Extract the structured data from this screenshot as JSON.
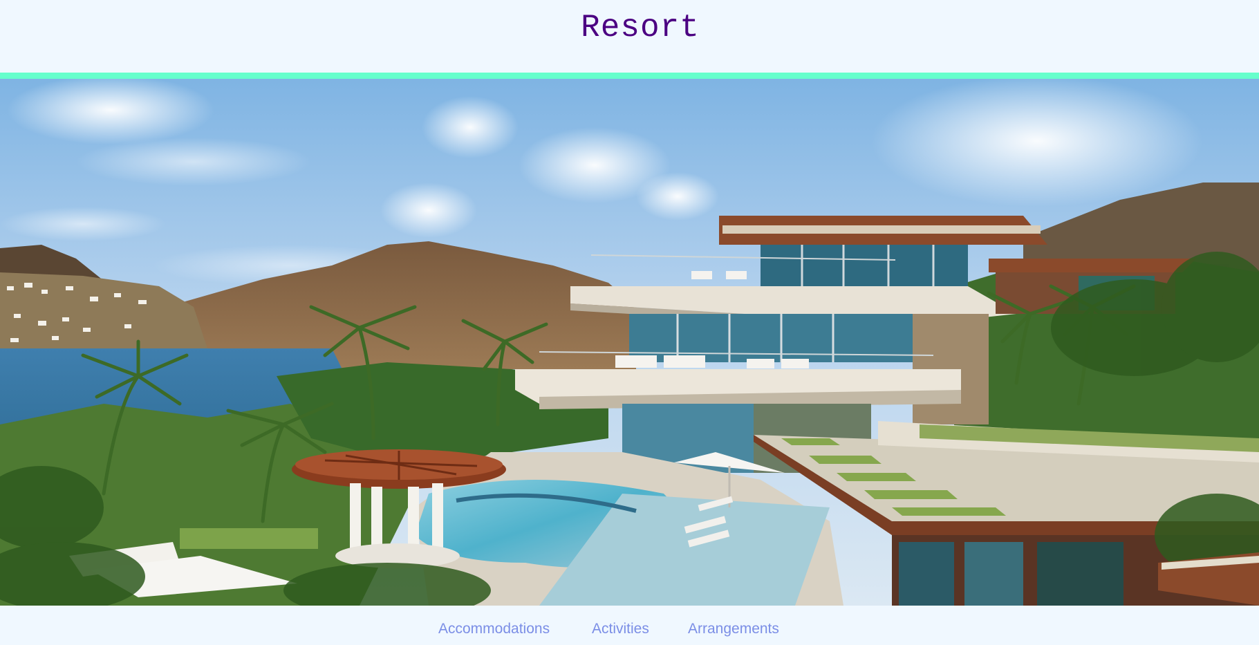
{
  "header": {
    "title": "Resort",
    "accent_color": "#66ffcc",
    "title_color": "#4b0082"
  },
  "hero": {
    "alt": "Luxury hillside resort villa with infinity pool overlooking a bay"
  },
  "nav": {
    "links": [
      {
        "label": "Accommodations"
      },
      {
        "label": "Activities"
      },
      {
        "label": "Arrangements"
      }
    ],
    "link_color": "#7b8ee6"
  }
}
